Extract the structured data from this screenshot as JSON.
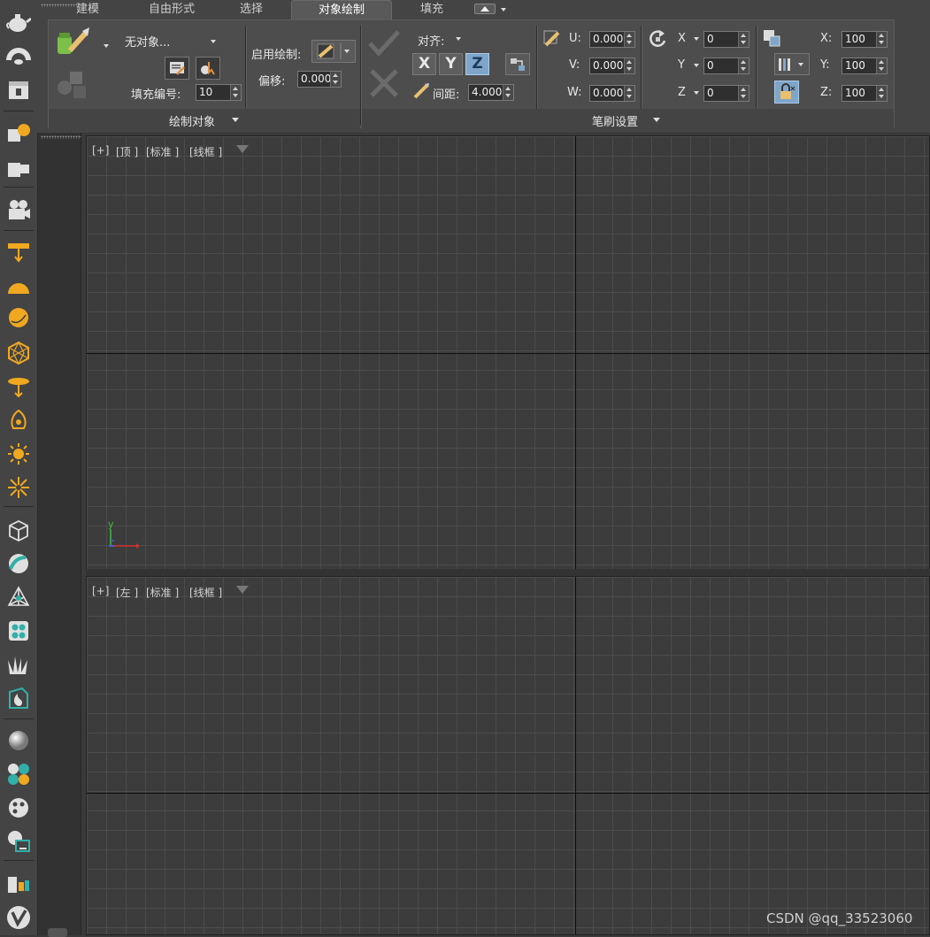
{
  "ribbon": {
    "tabs": [
      {
        "label": "建模",
        "active": false
      },
      {
        "label": "自由形式",
        "active": false
      },
      {
        "label": "选择",
        "active": false
      },
      {
        "label": "对象绘制",
        "active": true
      },
      {
        "label": "填充",
        "active": false
      }
    ],
    "paint_objects": {
      "object_dropdown": "无对象...",
      "fill_number_label": "填充编号:",
      "fill_number_value": "10",
      "enable_paint_label": "启用绘制:",
      "offset_label": "偏移:",
      "offset_value": "0.000",
      "footer_label": "绘制对象"
    },
    "brush_settings": {
      "align_label": "对齐:",
      "axis_x": "X",
      "axis_y": "Y",
      "axis_z": "Z",
      "active_axis": "Z",
      "spacing_label": "间距:",
      "spacing_value": "4.000",
      "u_label": "U:",
      "u_value": "0.000",
      "v_label": "V:",
      "v_value": "0.000",
      "w_label": "W:",
      "w_value": "0.000",
      "rot_x_label": "X",
      "rot_x_value": "0",
      "rot_y_label": "Y",
      "rot_y_value": "0",
      "rot_z_label": "Z",
      "rot_z_value": "0",
      "scale_x_label": "X:",
      "scale_x_value": "100",
      "scale_y_label": "Y:",
      "scale_y_value": "100",
      "scale_z_label": "Z:",
      "scale_z_value": "100",
      "footer_label": "笔刷设置"
    }
  },
  "viewports": {
    "top": {
      "plus": "[+]",
      "view": "[顶 ]",
      "shading": "[标准 ]",
      "style": "[线框 ]",
      "gizmo_y": "y"
    },
    "left": {
      "plus": "[+]",
      "view": "[左 ]",
      "shading": "[标准 ]",
      "style": "[线框 ]"
    }
  },
  "watermark": "CSDN @qq_33523060",
  "colors": {
    "accent_axis": "#7fa6c8",
    "toolbar_orange": "#f0a820",
    "toolbar_teal": "#30b0a8"
  }
}
